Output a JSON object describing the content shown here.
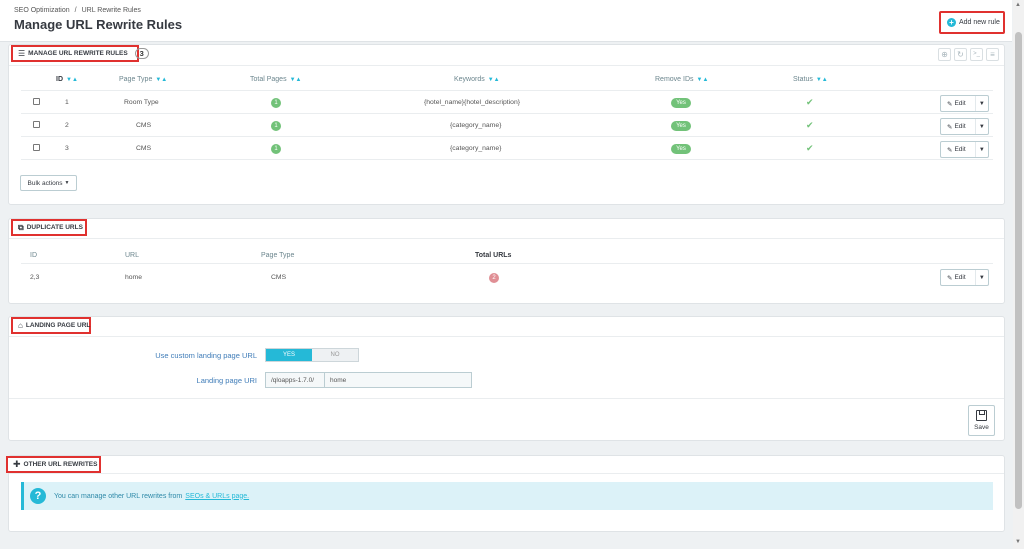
{
  "breadcrumb": {
    "first": "SEO Optimization",
    "sep": "/",
    "second": "URL Rewrite Rules"
  },
  "page_title": "Manage URL Rewrite Rules",
  "add_button": {
    "icon": "plus-circle-icon",
    "label": "Add new rule"
  },
  "rules_panel": {
    "title": "Manage URL Rewrite Rules",
    "count": "3",
    "icon": "list-icon",
    "columns": [
      "ID",
      "Page Type",
      "Total Pages",
      "Keywords",
      "Remove IDs",
      "Status"
    ],
    "rows": [
      {
        "id": "1",
        "page_type": "Room Type",
        "total_pages": "1",
        "keywords": "{hotel_name}{hotel_description}",
        "remove_ids": "Yes"
      },
      {
        "id": "2",
        "page_type": "CMS",
        "total_pages": "1",
        "keywords": "{category_name}",
        "remove_ids": "Yes"
      },
      {
        "id": "3",
        "page_type": "CMS",
        "total_pages": "1",
        "keywords": "{category_name}",
        "remove_ids": "Yes"
      }
    ],
    "edit_label": "Edit",
    "bulk_label": "Bulk actions"
  },
  "dup_panel": {
    "title": "Duplicate URLs",
    "icon": "copy-icon",
    "columns": [
      "ID",
      "URL",
      "Page Type",
      "Total URLs"
    ],
    "rows": [
      {
        "id": "2,3",
        "url": "home",
        "page_type": "CMS",
        "total_urls": "2"
      }
    ],
    "edit_label": "Edit"
  },
  "landing_panel": {
    "title": "Landing Page URL",
    "icon": "home-icon",
    "custom_label": "Use custom landing page URL",
    "yes_label": "YES",
    "no_label": "NO",
    "uri_label": "Landing page URI",
    "uri_prefix": "/qloapps-1.7.0/",
    "uri_value": "home",
    "save_label": "Save"
  },
  "other_panel": {
    "title": "Other URL Rewrites",
    "icon": "plus-icon",
    "info_text": "You can manage other URL rewrites from",
    "info_link": "SEOs & URLs page."
  },
  "colors": {
    "accent": "#25b9d7",
    "success": "#72c279",
    "danger": "#e08f95",
    "highlight": "#e0312f"
  }
}
